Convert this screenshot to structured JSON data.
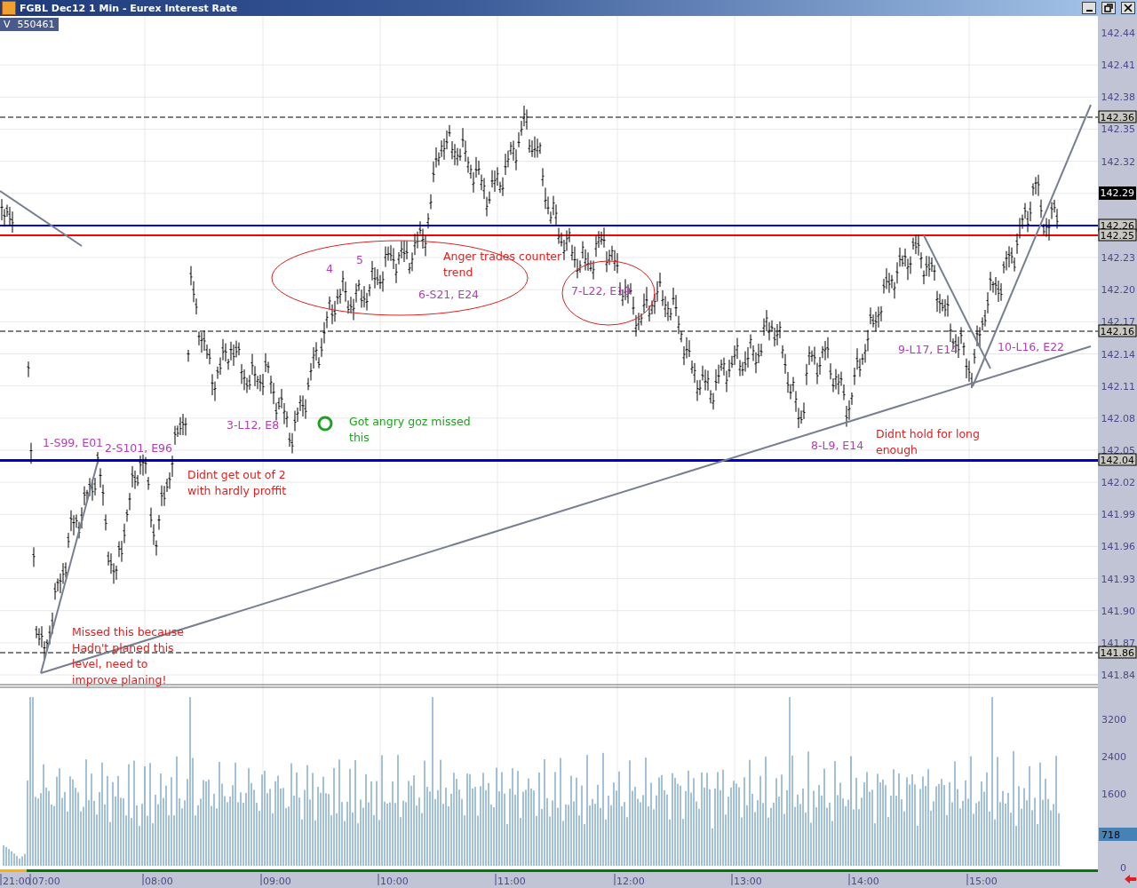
{
  "window": {
    "title": "FGBL Dec12 1 Min - Eurex Interest Rate"
  },
  "indicator": {
    "label": "V",
    "value": "550461"
  },
  "price_axis": {
    "upper_ticks": [
      "142.44",
      "142.41",
      "142.38",
      "142.35",
      "142.32"
    ],
    "lower_ticks": [
      "142.23",
      "142.20",
      "142.17",
      "142.14",
      "142.11",
      "142.08",
      "142.05",
      "142.02",
      "141.99",
      "141.96",
      "141.93",
      "141.90",
      "141.87",
      "141.84"
    ],
    "current": "142.29"
  },
  "levels": [
    {
      "label": "142.36",
      "kind": "dashed",
      "color": "#808080"
    },
    {
      "label": "142.26",
      "kind": "solid",
      "color": "#0000ff"
    },
    {
      "label": "142.25",
      "kind": "solid",
      "color": "#ff0000"
    },
    {
      "label": "142.16",
      "kind": "dashed",
      "color": "#808080"
    },
    {
      "label": "142.04",
      "kind": "thick",
      "color": "#0000cc"
    },
    {
      "label": "141.86",
      "kind": "dashed",
      "color": "#808080"
    }
  ],
  "annotations": [
    {
      "lines": [
        "1-S99, E01"
      ],
      "color": "#b040b0"
    },
    {
      "lines": [
        "2-S101, E96"
      ],
      "color": "#b040b0"
    },
    {
      "lines": [
        "3-L12, E8"
      ],
      "color": "#b040b0"
    },
    {
      "lines": [
        "4"
      ],
      "color": "#b040b0"
    },
    {
      "lines": [
        "5"
      ],
      "color": "#b040b0"
    },
    {
      "lines": [
        "6-S21, E24"
      ],
      "color": "#b040b0"
    },
    {
      "lines": [
        "7-L22, E19"
      ],
      "color": "#b040b0"
    },
    {
      "lines": [
        "8-L9, E14"
      ],
      "color": "#b040b0"
    },
    {
      "lines": [
        "9-L17, E14"
      ],
      "color": "#b040b0"
    },
    {
      "lines": [
        "10-L16, E22"
      ],
      "color": "#b040b0"
    },
    {
      "lines": [
        "Anger trades counter",
        "trend"
      ],
      "color": "#e02020"
    },
    {
      "lines": [
        "Didnt get out  of  2",
        "with hardly proffit"
      ],
      "color": "#e02020"
    },
    {
      "lines": [
        "Missed this because",
        "Hadn't planed this",
        "level, need to",
        "improve planing!"
      ],
      "color": "#e02020"
    },
    {
      "lines": [
        "Didnt hold for long",
        "enough"
      ],
      "color": "#e02020"
    },
    {
      "lines": [
        "Got angry goz missed",
        "this"
      ],
      "color": "#20a020"
    }
  ],
  "volume_axis": {
    "ticks": [
      "3200",
      "2400",
      "1600",
      "0"
    ],
    "current": "718"
  },
  "time_axis": {
    "ticks": [
      "21:00",
      "07:00",
      "08:00",
      "09:00",
      "10:00",
      "11:00",
      "12:00",
      "13:00",
      "14:00",
      "15:00"
    ]
  }
}
